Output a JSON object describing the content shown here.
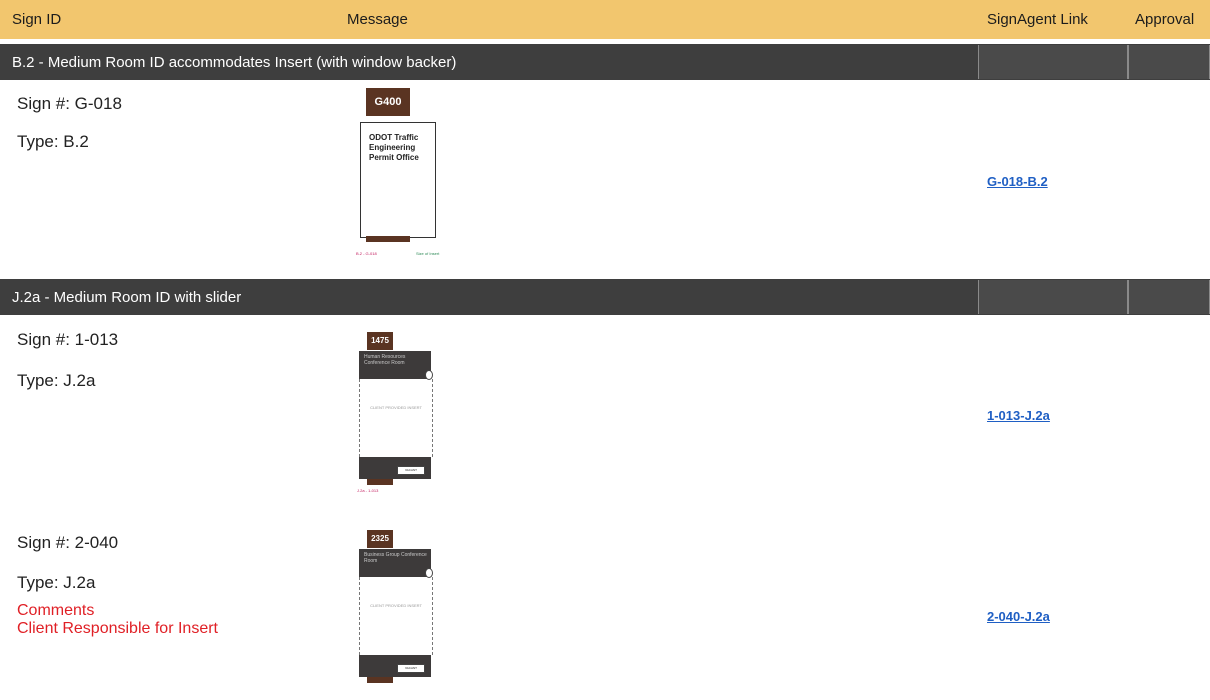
{
  "header": {
    "sign_id": "Sign ID",
    "message": "Message",
    "signagent_link": "SignAgent Link",
    "approval": "Approval"
  },
  "sections": [
    {
      "title": "B.2 - Medium Room ID accommodates Insert (with window backer)",
      "signs": [
        {
          "sign_number": "Sign #: G-018",
          "type": "Type: B.2",
          "link": "G-018-B.2",
          "thumb": {
            "room_number": "G400",
            "message": "ODOT Traffic Engineering Permit Office",
            "footnote_left": "B.2 - G-018",
            "footnote_right": "Size of Insert"
          }
        }
      ]
    },
    {
      "title": "J.2a - Medium Room ID with slider",
      "signs": [
        {
          "sign_number": "Sign #: 1-013",
          "type": "Type: J.2a",
          "link": "1-013-J.2a",
          "thumb": {
            "room_number": "1475",
            "message": "Human Resources Conference Room",
            "insert_note": "CLIENT PROVIDED INSERT",
            "slider": "VACANT",
            "footnote": "J.2a - 1-013"
          }
        },
        {
          "sign_number": "Sign #: 2-040",
          "type": "Type: J.2a",
          "comments_title": "Comments",
          "comments_text": "Client Responsible for Insert",
          "link": "2-040-J.2a",
          "thumb": {
            "room_number": "2325",
            "message": "Business Group Conference Room",
            "insert_note": "CLIENT PROVIDED INSERT",
            "slider": "VACANT"
          }
        }
      ]
    }
  ],
  "colors": {
    "header_bg": "#f2c66e",
    "section_bg": "#3e3e3e",
    "link": "#1f5fc4",
    "comment": "#e01f25",
    "sign_brown": "#5a3422"
  }
}
